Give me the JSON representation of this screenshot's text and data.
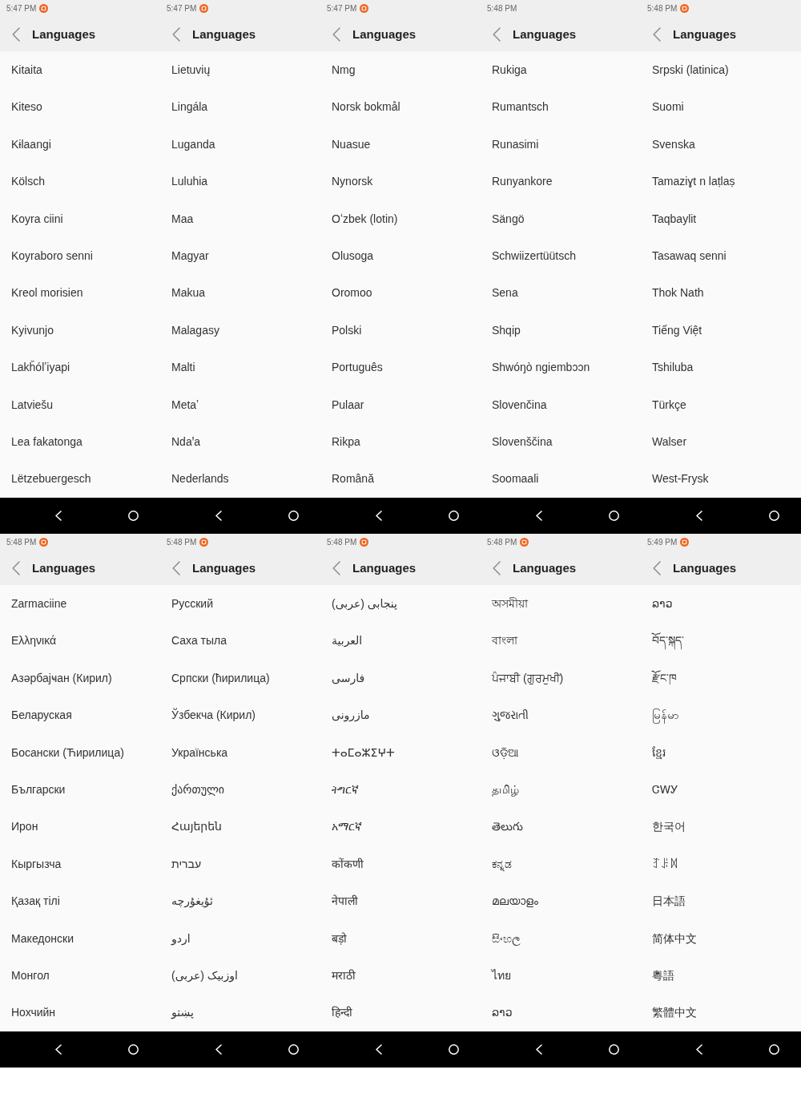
{
  "screens": [
    {
      "status_bar": {
        "time": "5:47 PM",
        "notification": true
      },
      "title": "Languages",
      "languages": [
        "Kitaita",
        "Kiteso",
        "Kɨlaangi",
        "Kölsch",
        "Koyra ciini",
        "Koyraboro senni",
        "Kreol morisien",
        "Kyivunjo",
        "Lakȟólʼiyapi",
        "Latviešu",
        "Lea fakatonga",
        "Lëtzebuergesch"
      ]
    },
    {
      "status_bar": {
        "time": "5:47 PM",
        "notification": true
      },
      "title": "Languages",
      "languages": [
        "Lietuvių",
        "Lingála",
        "Luganda",
        "Luluhia",
        "Maa",
        "Magyar",
        "Makua",
        "Malagasy",
        "Malti",
        "Metaʼ",
        "Ndaꞌa",
        "Nederlands"
      ]
    },
    {
      "status_bar": {
        "time": "5:47 PM",
        "notification": true
      },
      "title": "Languages",
      "languages": [
        "Nmg",
        "Norsk bokmål",
        "Nuasue",
        "Nynorsk",
        "Oʻzbek (lotin)",
        "Olusoga",
        "Oromoo",
        "Polski",
        "Português",
        "Pulaar",
        "Rikpa",
        "Română"
      ]
    },
    {
      "status_bar": {
        "time": "5:48 PM",
        "notification": false
      },
      "title": "Languages",
      "languages": [
        "Rukiga",
        "Rumantsch",
        "Runasimi",
        "Runyankore",
        "Sängö",
        "Schwiizertüütsch",
        "Sena",
        "Shqip",
        "Shwóŋò ngiembɔɔn",
        "Slovenčina",
        "Slovenščina",
        "Soomaali"
      ]
    },
    {
      "status_bar": {
        "time": "5:48 PM",
        "notification": true
      },
      "title": "Languages",
      "languages": [
        "Srpski (latinica)",
        "Suomi",
        "Svenska",
        "Tamaziɣt n laṭlaṣ",
        "Taqbaylit",
        "Tasawaq senni",
        "Thok Nath",
        "Tiếng Việt",
        "Tshiluba",
        "Türkçe",
        "Walser",
        "West-Frysk"
      ]
    },
    {
      "status_bar": {
        "time": "5:48 PM",
        "notification": true
      },
      "title": "Languages",
      "languages": [
        "Zarmaciine",
        "Ελληνικά",
        "Азәрбајҹан (Кирил)",
        "Беларуская",
        "Босански (Ћирилица)",
        "Български",
        "Ирон",
        "Кыргызча",
        "Қазақ тілі",
        "Македонски",
        "Монгол",
        "Нохчийн"
      ]
    },
    {
      "status_bar": {
        "time": "5:48 PM",
        "notification": true
      },
      "title": "Languages",
      "languages": [
        "Русский",
        "Саха тыла",
        "Српски (ћирилица)",
        "Ўзбекча (Кирил)",
        "Українська",
        "ქართული",
        "Հայերեն",
        "עברית",
        "ئۇيغۇرچە",
        "اردو",
        "اوزبیک (عربی)",
        "پښتو"
      ]
    },
    {
      "status_bar": {
        "time": "5:48 PM",
        "notification": true
      },
      "title": "Languages",
      "languages": [
        "پنجابی (عربی)",
        "العربية",
        "فارسی",
        "مازرونی",
        "ⵜⴰⵎⴰⵣⵉⵖⵜ",
        "ትግርኛ",
        "አማርኛ",
        "कोंकणी",
        "नेपाली",
        "बड़ो",
        "मराठी",
        "हिन्दी"
      ]
    },
    {
      "status_bar": {
        "time": "5:48 PM",
        "notification": true
      },
      "title": "Languages",
      "languages": [
        "অসমীয়া",
        "বাংলা",
        "ਪੰਜਾਬੀ (ਗੁਰਮੁਖੀ)",
        "ગુજરાતી",
        "ଓଡ଼ିଆ",
        "தமிழ்",
        "తెలుగు",
        "ಕನ್ನಡ",
        "മലയാളം",
        "සිංහල",
        "ไทย",
        "ລາວ"
      ]
    },
    {
      "status_bar": {
        "time": "5:49 PM",
        "notification": true
      },
      "title": "Languages",
      "languages": [
        "ລາວ",
        "བོད་སྐད་",
        "རྫོང་ཁ",
        "မြန်မာ",
        "ខ្មែរ",
        "ᏣᎳᎩ",
        "한국어",
        "ꆈꌠꉙ",
        "日本語",
        "简体中文",
        "粵語",
        "繁體中文"
      ]
    }
  ]
}
